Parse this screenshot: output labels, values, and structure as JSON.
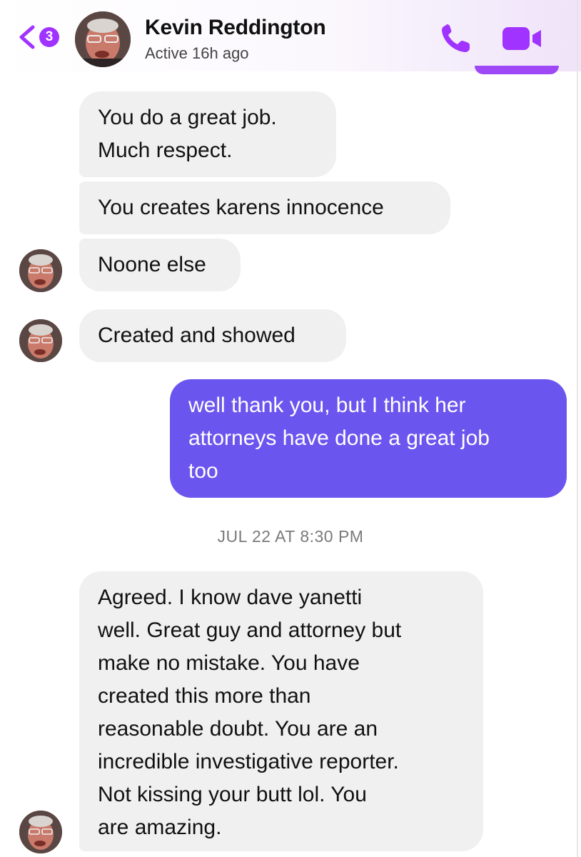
{
  "header": {
    "back_badge_count": "3",
    "contact_name": "Kevin Reddington",
    "status": "Active 16h ago",
    "accent_color": "#a033ff",
    "icons": [
      "chevron-left-icon",
      "phone-icon",
      "video-camera-icon"
    ]
  },
  "messages": [
    {
      "direction": "incoming",
      "text": "You do a great job.\nMuch respect."
    },
    {
      "direction": "incoming",
      "text": "You creates karens innocence"
    },
    {
      "direction": "incoming",
      "text": "Noone else"
    },
    {
      "direction": "incoming",
      "text": "Created and showed"
    },
    {
      "direction": "outgoing",
      "text": "well thank you, but I think her\nattorneys have done a great job\ntoo"
    },
    {
      "direction": "incoming",
      "text": "Agreed.  I know dave yanetti\nwell.  Great guy and attorney but\nmake no mistake.     You have\ncreated this more than\nreasonable doubt.  You are an\nincredible investigative reporter.\nNot kissing your butt lol.  You\nare amazing."
    }
  ],
  "timestamp": "JUL 22 AT 8:30 PM",
  "colors": {
    "incoming_bubble": "#f0f0f0",
    "outgoing_bubble": "#6a56ef",
    "outgoing_text": "#ffffff"
  }
}
